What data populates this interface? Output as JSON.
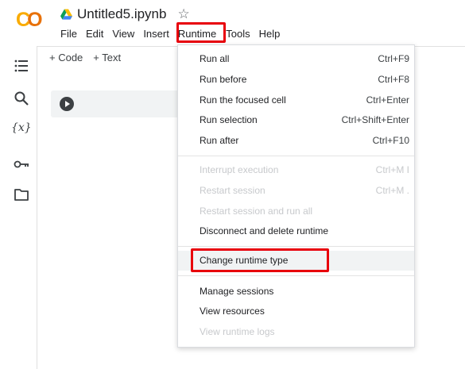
{
  "app": {
    "logo_text_c": "C",
    "logo_text_o": "O",
    "notebook_title": "Untitled5.ipynb",
    "star_glyph": "☆"
  },
  "menubar": [
    "File",
    "Edit",
    "View",
    "Insert",
    "Runtime",
    "Tools",
    "Help"
  ],
  "toolbar": {
    "add_code": "+ Code",
    "add_text": "+ Text"
  },
  "sidebar": {
    "icons": [
      "table-of-contents-icon",
      "search-icon",
      "variables-icon",
      "key-icon",
      "folder-icon"
    ],
    "variables_glyph": "{x}"
  },
  "runtime_menu": {
    "items": [
      {
        "label": "Run all",
        "shortcut": "Ctrl+F9",
        "enabled": true
      },
      {
        "label": "Run before",
        "shortcut": "Ctrl+F8",
        "enabled": true
      },
      {
        "label": "Run the focused cell",
        "shortcut": "Ctrl+Enter",
        "enabled": true
      },
      {
        "label": "Run selection",
        "shortcut": "Ctrl+Shift+Enter",
        "enabled": true
      },
      {
        "label": "Run after",
        "shortcut": "Ctrl+F10",
        "enabled": true
      },
      {
        "label": "Interrupt execution",
        "shortcut": "Ctrl+M I",
        "enabled": false
      },
      {
        "label": "Restart session",
        "shortcut": "Ctrl+M .",
        "enabled": false
      },
      {
        "label": "Restart session and run all",
        "shortcut": "",
        "enabled": false
      },
      {
        "label": "Disconnect and delete runtime",
        "shortcut": "",
        "enabled": true
      },
      {
        "label": "Change runtime type",
        "shortcut": "",
        "enabled": true,
        "highlighted": true
      },
      {
        "label": "Manage sessions",
        "shortcut": "",
        "enabled": true
      },
      {
        "label": "View resources",
        "shortcut": "",
        "enabled": true
      },
      {
        "label": "View runtime logs",
        "shortcut": "",
        "enabled": false
      }
    ]
  },
  "colors": {
    "highlight_box": "#e8000b",
    "logo_yellow": "#f9ab00",
    "logo_orange": "#e8710a",
    "disabled_text": "#c7c9cc"
  }
}
